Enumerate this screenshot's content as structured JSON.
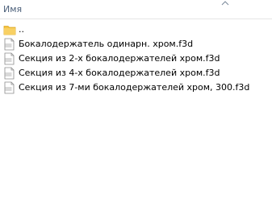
{
  "header": {
    "name_column_label": "Имя"
  },
  "files": [
    {
      "name": "..",
      "type": "folder",
      "icon": "folder-icon"
    },
    {
      "name": "Бокалодержатель одинарн. хром.f3d",
      "type": "file",
      "icon": "f3d-file-icon"
    },
    {
      "name": "Секция из 2-х бокалодержателей хром.f3d",
      "type": "file",
      "icon": "f3d-file-icon"
    },
    {
      "name": "Секция из 4-х бокалодержателей хром.f3d",
      "type": "file",
      "icon": "f3d-file-icon"
    },
    {
      "name": "Секция из 7-ми бокалодержателей хром, 300.f3d",
      "type": "file",
      "icon": "f3d-file-icon"
    }
  ],
  "colors": {
    "header_text": "#4c607a",
    "folder": "#f5c342",
    "file_icon_bg": "#d9d9d9",
    "divider": "#e5e5e5"
  }
}
